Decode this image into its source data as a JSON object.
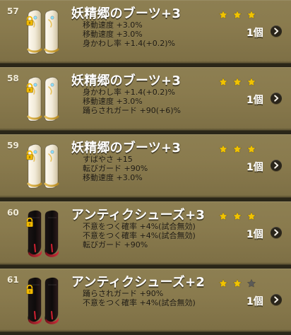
{
  "colors": {
    "row_background": "#8a7b4e",
    "name_text": "#ffffff",
    "stat_text": "#1e1a12",
    "star_gold": "#f1c300",
    "star_inactive": "#5b5a57",
    "lock_gold": "#f0b800",
    "button_bg": "#2a251a"
  },
  "items": [
    {
      "number": "57",
      "name": "妖精郷のブーツ+3",
      "stats": [
        "移動速度 +3.0%",
        "移動速度 +3.0%",
        "身かわし率 +1.4(+0.2)%"
      ],
      "stars": {
        "filled": 3,
        "total": 3
      },
      "quantity": "1個",
      "locked": true,
      "icon": "fairy-boots-icon"
    },
    {
      "number": "58",
      "name": "妖精郷のブーツ+3",
      "stats": [
        "身かわし率 +1.4(+0.2)%",
        "移動速度 +3.0%",
        "踊らされガード +90(+6)%"
      ],
      "stars": {
        "filled": 3,
        "total": 3
      },
      "quantity": "1個",
      "locked": true,
      "icon": "fairy-boots-icon"
    },
    {
      "number": "59",
      "name": "妖精郷のブーツ+3",
      "stats": [
        "すばやさ +15",
        "転びガード +90%",
        "移動速度 +3.0%"
      ],
      "stars": {
        "filled": 3,
        "total": 3
      },
      "quantity": "1個",
      "locked": true,
      "icon": "fairy-boots-icon"
    },
    {
      "number": "60",
      "name": "アンティクシューズ+3",
      "stats": [
        "不意をつく確率 +4%(試合無効)",
        "不意をつく確率 +4%(試合無効)",
        "転びガード +90%"
      ],
      "stars": {
        "filled": 3,
        "total": 3
      },
      "quantity": "1個",
      "locked": true,
      "icon": "antique-shoes-icon"
    },
    {
      "number": "61",
      "name": "アンティクシューズ+2",
      "stats": [
        "踊らされガード +90%",
        "不意をつく確率 +4%(試合無効)"
      ],
      "stars": {
        "filled": 2,
        "total": 3
      },
      "quantity": "1個",
      "locked": true,
      "icon": "antique-shoes-icon"
    }
  ]
}
